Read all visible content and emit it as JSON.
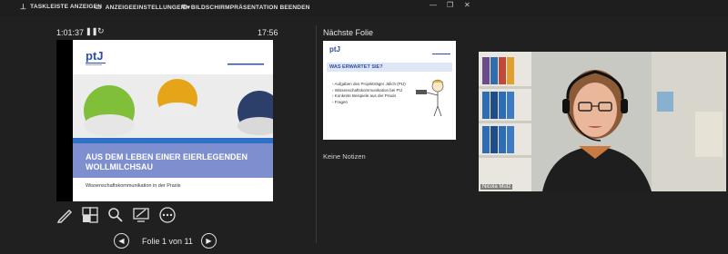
{
  "toolbar": {
    "taskbar_label": "TASKLEISTE ANZEIGEN",
    "display_settings_label": "ANZEIGEEINSTELLUNGEN ▾",
    "end_show_label": "BILDSCHIRMPRÄSENTATION BEENDEN"
  },
  "presenter": {
    "elapsed_time": "1:01:37",
    "clock": "17:56",
    "next_slide_label": "Nächste Folie",
    "notes_label": "Keine Notizen",
    "slide_counter": "Folie 1 von 11"
  },
  "current_slide": {
    "logo": "ptJ",
    "headline_line1": "AUS DEM LEBEN EINER EIERLEGENDEN",
    "headline_line2": "WOLLMILCHSAU",
    "subtitle": "Wissenschaftskommunikation in der Praxis"
  },
  "next_slide": {
    "logo": "ptJ",
    "heading": "WAS ERWARTET SIE?",
    "bullets": [
      "Aufgaben des Projektträger Jülich (PtJ)",
      "Wissenschaftskommunikation bei PtJ",
      "Konkrete Beispiele aus der Praxis",
      "Fragen"
    ]
  },
  "video": {
    "participant_name": "Nicola Mutz"
  },
  "colors": {
    "background": "#202020",
    "slide_band": "#7e8fd0",
    "brand_blue": "#2e4fa3"
  },
  "icons": [
    "pen-icon",
    "slides-grid-icon",
    "zoom-icon",
    "screen-share-icon",
    "more-icon",
    "prev-icon",
    "next-icon"
  ]
}
